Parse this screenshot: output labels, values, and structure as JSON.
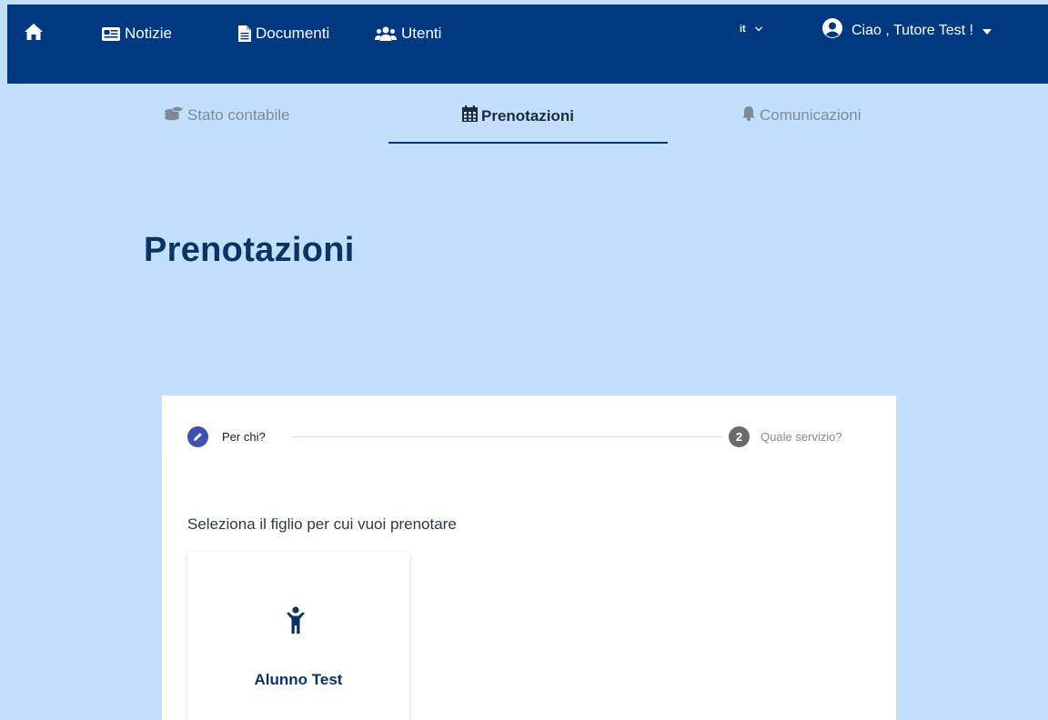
{
  "nav": {
    "home_icon": "home-icon",
    "links": [
      {
        "label": "Notizie",
        "icon": "newspaper-icon"
      },
      {
        "label": "Documenti",
        "icon": "file-icon"
      },
      {
        "label": "Utenti",
        "icon": "users-icon"
      }
    ],
    "language": "it",
    "greeting": "Ciao , Tutore Test !"
  },
  "tabs": [
    {
      "label": "Stato contabile",
      "icon": "coins-icon",
      "active": false
    },
    {
      "label": "Prenotazioni",
      "icon": "calendar-icon",
      "active": true
    },
    {
      "label": "Comunicazioni",
      "icon": "bell-icon",
      "active": false
    }
  ],
  "page": {
    "title": "Prenotazioni"
  },
  "stepper": {
    "step1_label": "Per chi?",
    "step2_number": "2",
    "step2_label": "Quale servizio?"
  },
  "selection": {
    "instruction": "Seleziona il figlio per cui vuoi prenotare",
    "children": [
      {
        "name": "Alunno Test",
        "icon": "child-icon"
      }
    ]
  },
  "colors": {
    "navbar": "#00397f",
    "background": "#c2dffb",
    "title": "#0b3466",
    "step_active": "#3f51b5",
    "step_inactive": "#6b6b6b"
  }
}
